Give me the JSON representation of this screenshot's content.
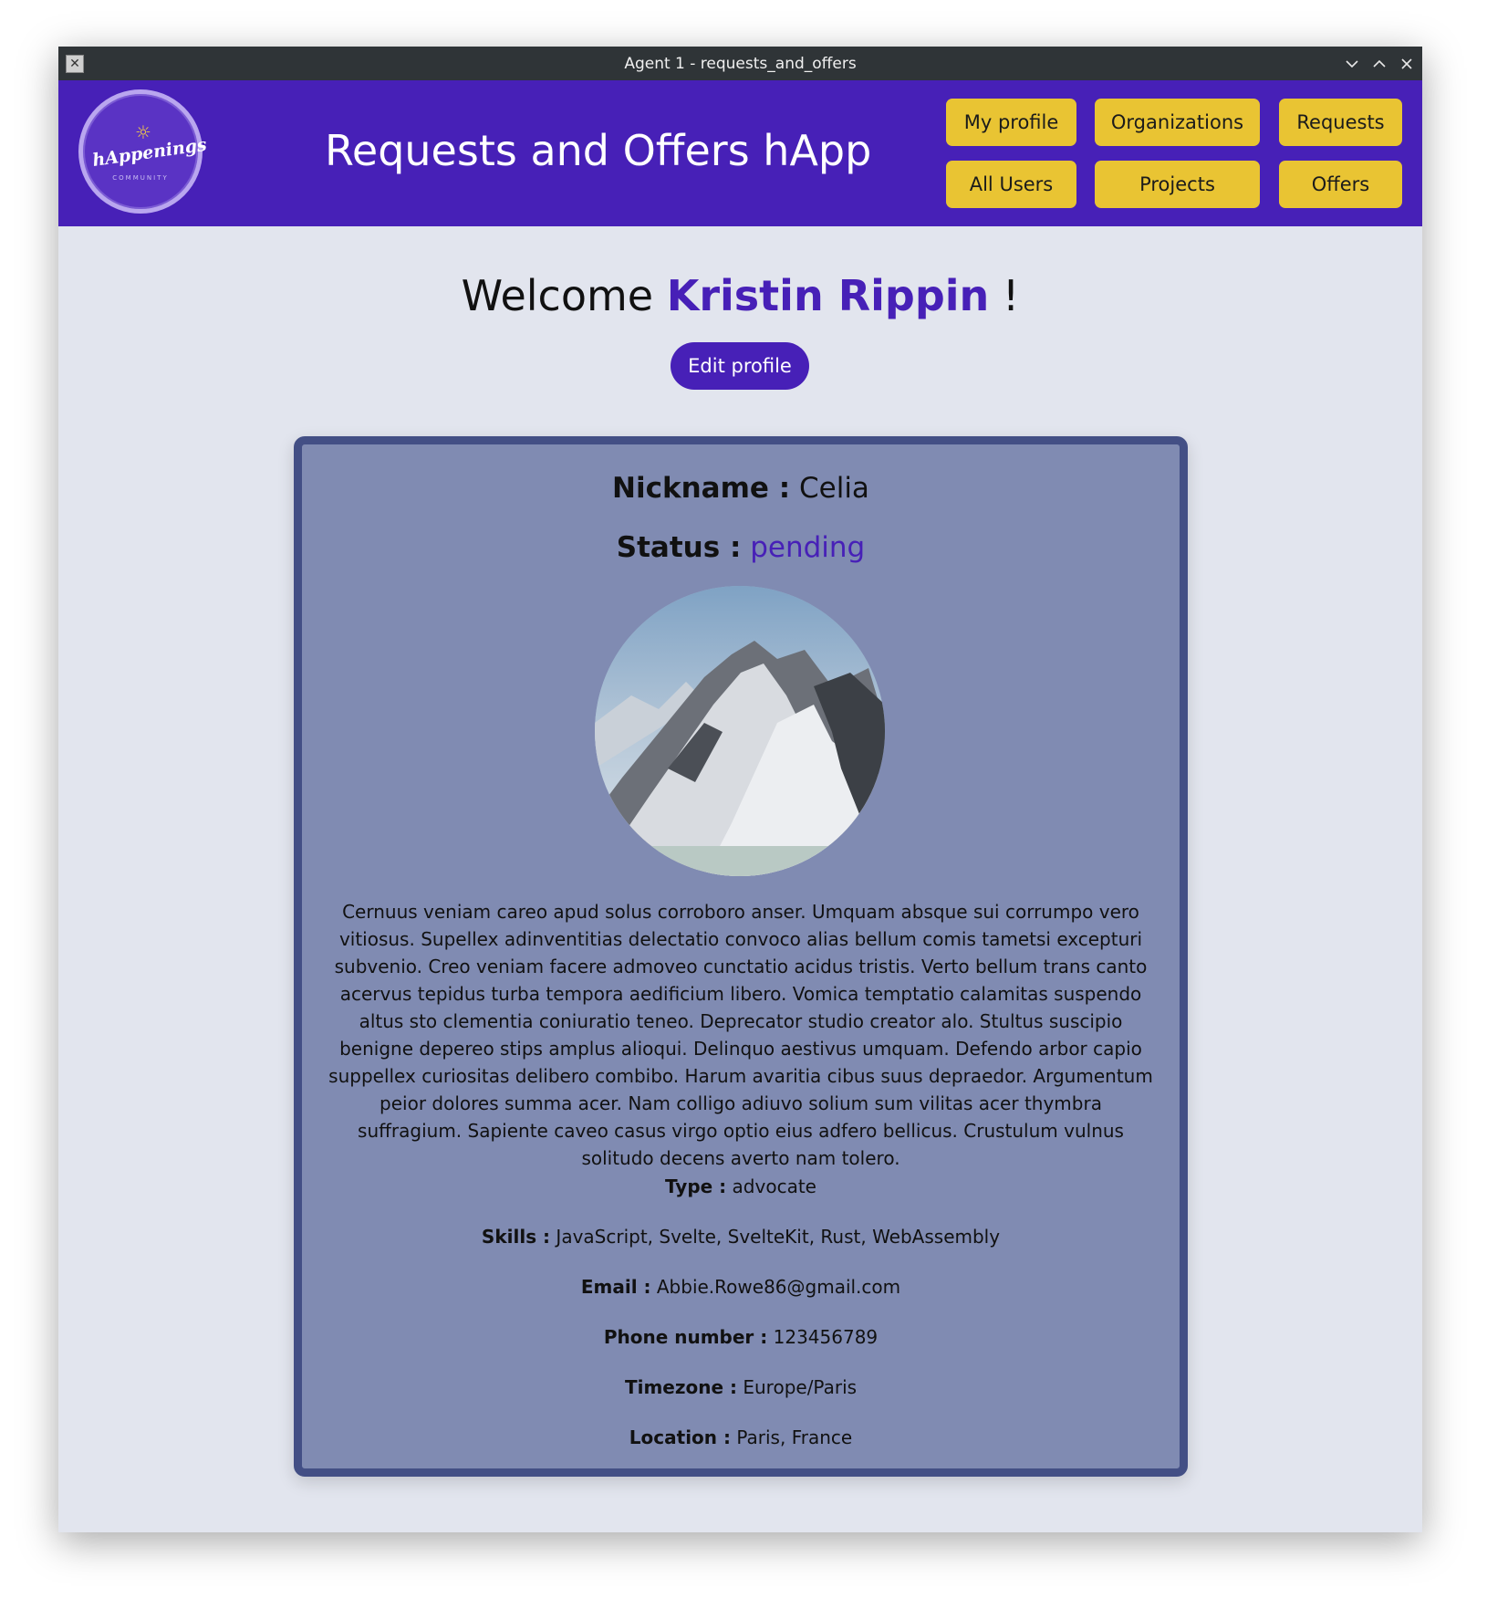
{
  "window": {
    "title": "Agent 1 - requests_and_offers",
    "controls": [
      "chevron-down-icon",
      "chevron-up-icon",
      "close-icon"
    ]
  },
  "header": {
    "logo_text": "hAppenings",
    "logo_subtext": "COMMUNITY",
    "title": "Requests and Offers hApp",
    "nav": {
      "my_profile": "My profile",
      "organizations": "Organizations",
      "requests": "Requests",
      "all_users": "All Users",
      "projects": "Projects",
      "offers": "Offers"
    }
  },
  "welcome": {
    "prefix": "Welcome ",
    "name": "Kristin Rippin",
    "suffix": " !"
  },
  "edit_profile_label": "Edit profile",
  "profile": {
    "nickname_label": "Nickname :",
    "nickname": "Celia",
    "status_label": "Status :",
    "status": "pending",
    "bio": "Cernuus veniam careo apud solus corroboro anser. Umquam absque sui corrumpo vero vitiosus. Supellex adinventitias delectatio convoco alias bellum comis tametsi excepturi subvenio. Creo veniam facere admoveo cunctatio acidus tristis. Verto bellum trans canto acervus tepidus turba tempora aedificium libero. Vomica temptatio calamitas suspendo altus sto clementia coniuratio teneo. Deprecator studio creator alo. Stultus suscipio benigne depereo stips amplus alioqui. Delinquo aestivus umquam. Defendo arbor capio suppellex curiositas delibero combibo. Harum avaritia cibus suus depraedor. Argumentum peior dolores summa acer. Nam colligo adiuvo solium sum vilitas acer thymbra suffragium. Sapiente caveo casus virgo optio eius adfero bellicus. Crustulum vulnus solitudo decens averto nam tolero.",
    "type_label": "Type :",
    "type": "advocate",
    "skills_label": "Skills :",
    "skills": "JavaScript, Svelte, SvelteKit, Rust, WebAssembly",
    "email_label": "Email :",
    "email": "Abbie.Rowe86@gmail.com",
    "phone_label": "Phone number :",
    "phone": "123456789",
    "timezone_label": "Timezone :",
    "timezone": "Europe/Paris",
    "location_label": "Location :",
    "location": "Paris, France"
  },
  "colors": {
    "header_bg": "#4720b7",
    "nav_button": "#e9c433",
    "card_bg": "#808bb2",
    "card_border": "#434f85",
    "page_bg": "#e2e5ee"
  }
}
